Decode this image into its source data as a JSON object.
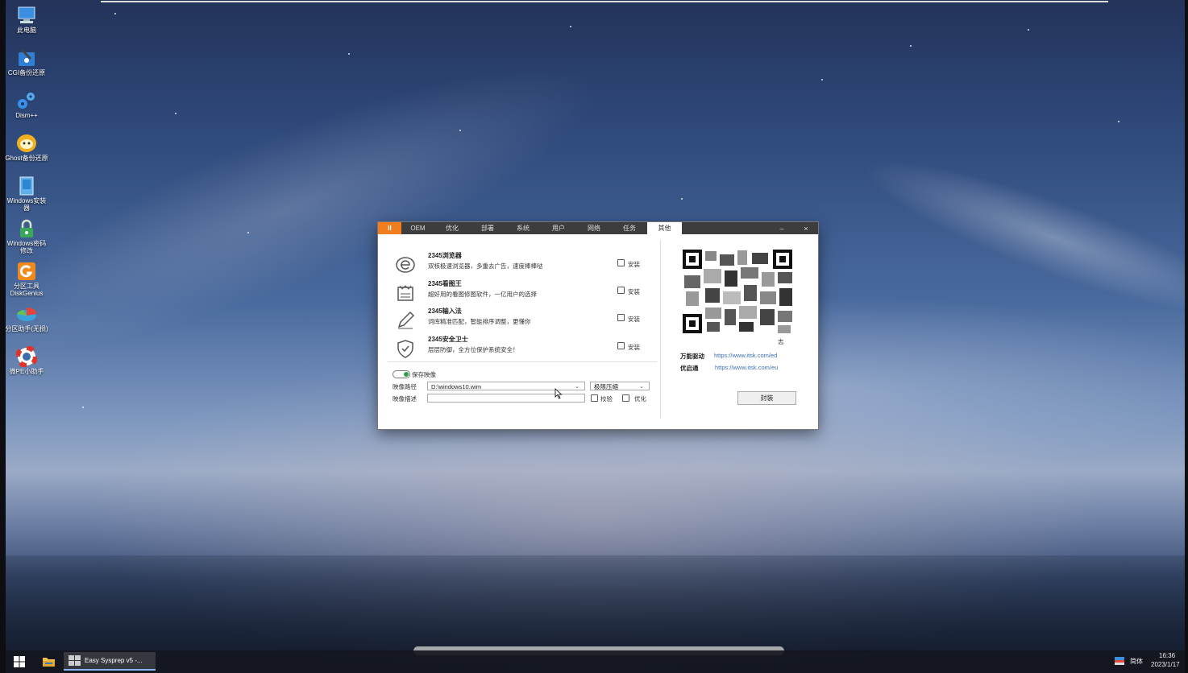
{
  "desktop": {
    "icons": [
      {
        "label": "此电脑",
        "icon": "computer-icon"
      },
      {
        "label": "CGI备份还原",
        "icon": "cgi-backup-icon"
      },
      {
        "label": "Dism++",
        "icon": "dism-gears-icon"
      },
      {
        "label": "Ghost备份还原",
        "icon": "ghost-icon"
      },
      {
        "label": "Windows安装器",
        "icon": "windows-installer-icon"
      },
      {
        "label": "Windows密码修改",
        "icon": "lock-icon"
      },
      {
        "label": "分区工具DiskGenius",
        "icon": "diskgenius-icon"
      },
      {
        "label": "分区助手(无损)",
        "icon": "partition-assistant-icon"
      },
      {
        "label": "微PE小助手",
        "icon": "lifebuoy-icon"
      }
    ]
  },
  "window": {
    "title": "Easy Sysprep v5",
    "tabs": [
      "OEM",
      "优化",
      "部署",
      "系统",
      "用户",
      "网络",
      "任务",
      "其他"
    ],
    "active_tab": "其他",
    "minimize": "–",
    "close": "×",
    "software": [
      {
        "name": "2345浏览器",
        "desc": "双核极速浏览器，多重去广告，速度棒棒哒",
        "install_label": "安装",
        "icon": "browser-e-icon"
      },
      {
        "name": "2345看图王",
        "desc": "超好用的看图修图软件，一亿用户的选择",
        "install_label": "安装",
        "icon": "image-viewer-icon"
      },
      {
        "name": "2345输入法",
        "desc": "词库精准匹配，智能排序调整，更懂你",
        "install_label": "安装",
        "icon": "pen-icon"
      },
      {
        "name": "2345安全卫士",
        "desc": "层层防御，全方位保护系统安全！",
        "install_label": "安装",
        "icon": "shield-icon"
      }
    ],
    "save_image_label": "保存映像",
    "image_path_label": "映像路径",
    "image_path_value": "D:\\windows10.wim",
    "compression_value": "极限压缩",
    "image_desc_label": "映像描述",
    "image_desc_value": "",
    "verify_label": "校验",
    "optimize_label": "优化",
    "qr_caption": "志",
    "links": [
      {
        "label": "万能驱动",
        "url": "https://www.itsk.com/ed"
      },
      {
        "label": "优启通",
        "url": "https://www.itsk.com/eu"
      }
    ],
    "seal_button": "封装"
  },
  "taskbar": {
    "app_label": "Easy Sysprep v5 -...",
    "ime": "简体",
    "time": "16:36",
    "date": "2023/1/17"
  }
}
